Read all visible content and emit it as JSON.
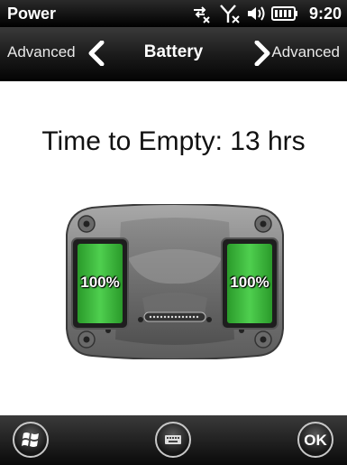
{
  "status_bar": {
    "title": "Power",
    "time": "9:20",
    "icons": [
      "sync-disconnected-icon",
      "signal-off-icon",
      "volume-icon",
      "battery-icon"
    ]
  },
  "nav": {
    "left_label": "Advanced",
    "title": "Battery",
    "right_label": "Advanced"
  },
  "main": {
    "time_to_empty": "Time to Empty: 13 hrs",
    "batteries": [
      {
        "label": "100%",
        "level": 1.0
      },
      {
        "label": "100%",
        "level": 1.0
      }
    ],
    "battery_color": "#3ab83a"
  },
  "bottom_bar": {
    "start_icon": "windows-start-icon",
    "keyboard_icon": "keyboard-icon",
    "ok_label": "OK"
  }
}
